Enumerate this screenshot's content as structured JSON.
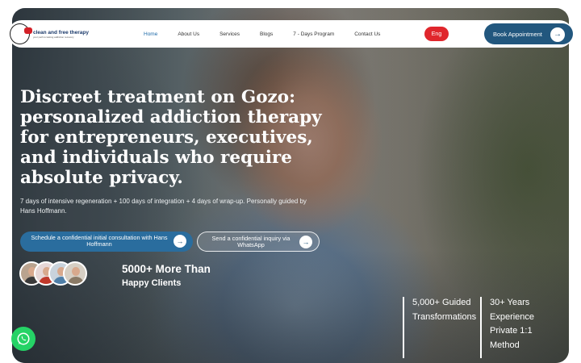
{
  "brand": {
    "logo_text": "clean and free therapy",
    "logo_tagline": "your path to lasting addiction recovery"
  },
  "nav": {
    "items": [
      {
        "label": "Home",
        "active": true
      },
      {
        "label": "About Us"
      },
      {
        "label": "Services"
      },
      {
        "label": "Blogs"
      },
      {
        "label": "7 - Days Program"
      },
      {
        "label": "Contact Us"
      }
    ],
    "language_label": "Eng",
    "book_label": "Book Appointment"
  },
  "hero": {
    "headline": "Discreet treatment on Gozo: personalized addiction therapy for entrepreneurs, executives, and individuals who require absolute privacy.",
    "subtext": "7 days of intensive regeneration + 100 days of integration + 4 days of wrap-up. Personally guided by Hans Hoffmann.",
    "cta_primary": "Schedule a confidential initial consultation with Hans Hoffmann",
    "cta_secondary": "Send a confidential inquiry via WhatsApp"
  },
  "clients": {
    "count": "5000+ More Than",
    "label": "Happy Clients"
  },
  "stats": [
    {
      "line1": "5,000+ Guided",
      "line2": "Transformations"
    },
    {
      "line1": "30+ Years",
      "line2": "Experience",
      "line3": "Private 1:1",
      "line4": "Method"
    }
  ],
  "colors": {
    "accent_blue": "#22577e",
    "lang_red": "#e0262c",
    "whatsapp_green": "#25d366"
  },
  "icons": {
    "arrow": "arrow-right-icon",
    "whatsapp": "whatsapp-icon"
  }
}
